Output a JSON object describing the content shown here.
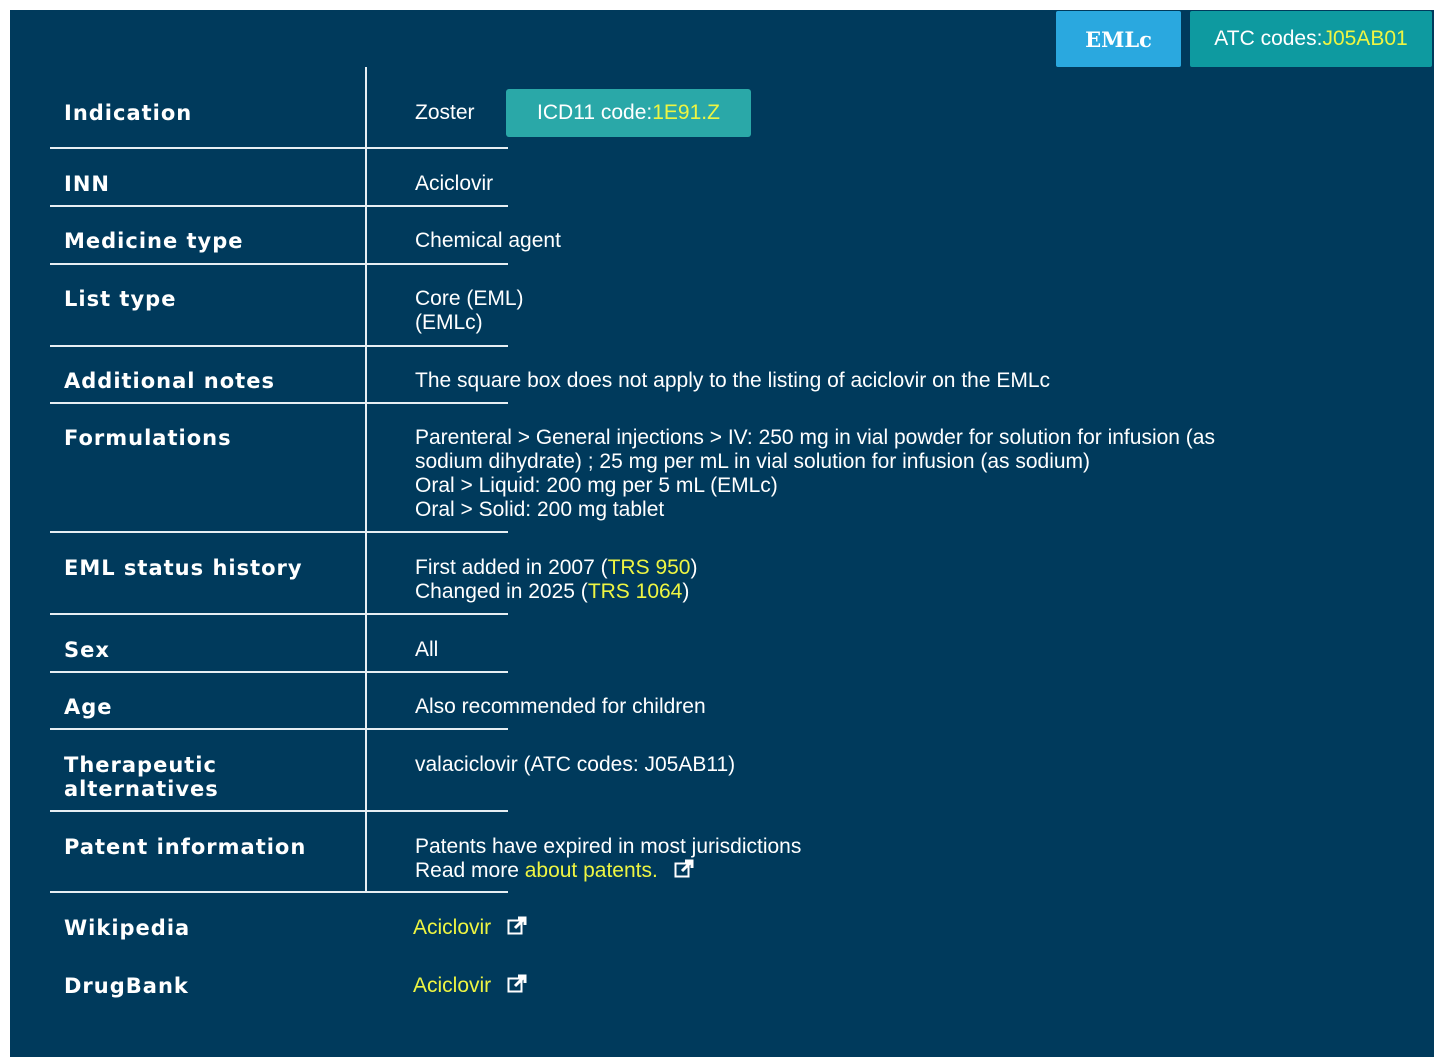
{
  "header": {
    "eml_badge": "EMLc",
    "atc_label": "ATC codes: ",
    "atc_code": "J05AB01"
  },
  "rows": {
    "indication": {
      "label": "Indication",
      "value": "Zoster",
      "icd_label": "ICD11 code: ",
      "icd_code": "1E91.Z"
    },
    "inn": {
      "label": "INN",
      "value": "Aciclovir"
    },
    "medicine_type": {
      "label": "Medicine type",
      "value": "Chemical agent"
    },
    "list_type": {
      "label": "List type",
      "line1": "Core (EML)",
      "line2": "(EMLc)"
    },
    "additional_notes": {
      "label": "Additional notes",
      "value": "The square box does not apply to the listing of aciclovir on the EMLc"
    },
    "formulations": {
      "label": "Formulations",
      "line1": "Parenteral > General injections > IV: 250 mg in vial powder for solution for infusion (as",
      "line2": "sodium dihydrate) ; 25 mg per mL in vial solution for infusion (as sodium)",
      "line3": "Oral > Liquid: 200 mg per 5 mL (EMLc)",
      "line4": "Oral > Solid: 200 mg tablet"
    },
    "eml_status": {
      "label": "EML status history",
      "line1_pre": "First added in 2007 (",
      "line1_link": "TRS 950",
      "line1_post": ")",
      "line2_pre": "Changed in 2025 (",
      "line2_link": "TRS 1064",
      "line2_post": ")"
    },
    "sex": {
      "label": "Sex",
      "value": "All"
    },
    "age": {
      "label": "Age",
      "value": "Also recommended for children"
    },
    "therapeutic": {
      "label_line1": "Therapeutic",
      "label_line2": "alternatives",
      "value": "valaciclovir (ATC codes: J05AB11)"
    },
    "patent": {
      "label": "Patent information",
      "line1": "Patents have expired in most jurisdictions",
      "line2_pre": "Read more ",
      "line2_link": "about patents."
    },
    "wikipedia": {
      "label": "Wikipedia",
      "link": "Aciclovir"
    },
    "drugbank": {
      "label": "DrugBank",
      "link": "Aciclovir"
    }
  },
  "icons": {
    "external": "external-link-icon"
  },
  "colors": {
    "panel_bg": "#003a5c",
    "link": "#eef542",
    "eml_badge_bg": "#2aa8df",
    "atc_badge_bg": "#0e9aa0",
    "icd_badge_bg": "#2aa8a8"
  }
}
